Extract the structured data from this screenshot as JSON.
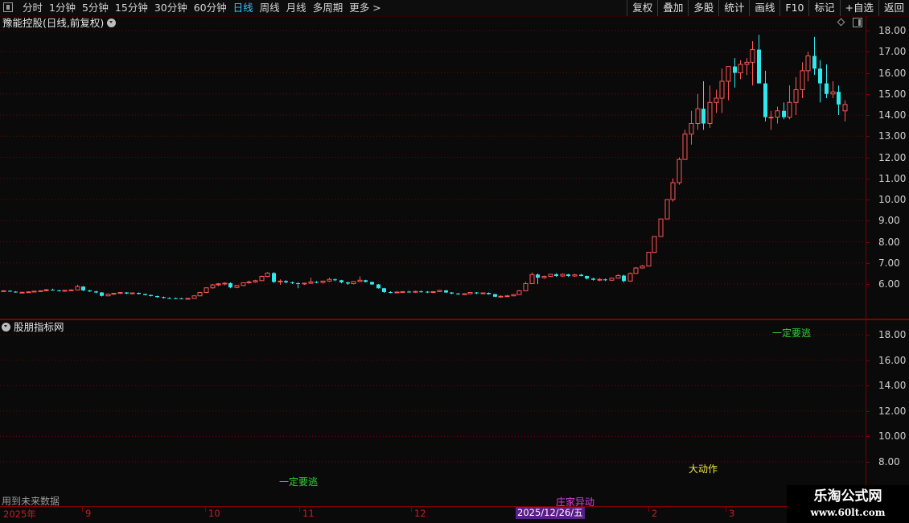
{
  "toolbar": {
    "periods": [
      "分时",
      "1分钟",
      "5分钟",
      "15分钟",
      "30分钟",
      "60分钟",
      "日线",
      "周线",
      "月线",
      "多周期",
      "更多 >"
    ],
    "active_period": "日线",
    "right_buttons": [
      "复权",
      "叠加",
      "多股",
      "统计",
      "画线",
      "F10",
      "标记",
      "+自选",
      "返回"
    ]
  },
  "main_panel": {
    "title": "豫能控股(日线,前复权)",
    "y_ticks": [
      "18.00",
      "17.00",
      "16.00",
      "15.00",
      "14.00",
      "13.00",
      "12.00",
      "11.00",
      "10.00",
      "9.00",
      "8.00",
      "7.00",
      "6.00"
    ]
  },
  "sub_panel": {
    "title": "股朋指标网",
    "y_ticks": [
      "18.00",
      "16.00",
      "14.00",
      "12.00",
      "10.00",
      "8.00"
    ],
    "signals": {
      "yiding_yaotao_1": "一定要逃",
      "yiding_yaotao_2": "一定要逃",
      "dadongzuo": "大动作",
      "zhuangjia_yidong": "庄家异动"
    },
    "future_data_note": "用到未来数据"
  },
  "x_axis": {
    "labels": [
      "2025年",
      "9",
      "10",
      "11",
      "12",
      "2",
      "3"
    ],
    "cursor_date": "2025/12/26/五"
  },
  "watermark": {
    "line1": "乐淘公式网",
    "line2": "www.60lt.com"
  },
  "colors": {
    "up": "#ff5555",
    "down": "#2ee8ee",
    "frame": "#800000",
    "active_tab": "#2ec7ff"
  },
  "chart_data": {
    "type": "candlestick",
    "title": "豫能控股(日线,前复权)",
    "ylim": [
      5.0,
      18.3
    ],
    "x_labels": [
      "2025年",
      "9",
      "10",
      "11",
      "12",
      "2025/12/26/五",
      "2",
      "3"
    ],
    "candles": [
      [
        5.66,
        5.7,
        5.64,
        5.68
      ],
      [
        5.68,
        5.7,
        5.63,
        5.64
      ],
      [
        5.64,
        5.66,
        5.59,
        5.6
      ],
      [
        5.6,
        5.63,
        5.56,
        5.61
      ],
      [
        5.61,
        5.65,
        5.58,
        5.63
      ],
      [
        5.63,
        5.68,
        5.61,
        5.66
      ],
      [
        5.66,
        5.7,
        5.63,
        5.68
      ],
      [
        5.68,
        5.76,
        5.66,
        5.73
      ],
      [
        5.73,
        5.78,
        5.69,
        5.7
      ],
      [
        5.7,
        5.73,
        5.65,
        5.67
      ],
      [
        5.67,
        5.72,
        5.64,
        5.7
      ],
      [
        5.7,
        5.75,
        5.67,
        5.72
      ],
      [
        5.72,
        5.96,
        5.7,
        5.88
      ],
      [
        5.88,
        5.9,
        5.66,
        5.7
      ],
      [
        5.7,
        5.72,
        5.63,
        5.65
      ],
      [
        5.65,
        5.68,
        5.56,
        5.6
      ],
      [
        5.6,
        5.62,
        5.41,
        5.44
      ],
      [
        5.44,
        5.55,
        5.42,
        5.52
      ],
      [
        5.52,
        5.58,
        5.49,
        5.56
      ],
      [
        5.56,
        5.62,
        5.53,
        5.6
      ],
      [
        5.6,
        5.62,
        5.52,
        5.55
      ],
      [
        5.55,
        5.6,
        5.52,
        5.58
      ],
      [
        5.58,
        5.6,
        5.51,
        5.53
      ],
      [
        5.53,
        5.55,
        5.46,
        5.48
      ],
      [
        5.48,
        5.5,
        5.41,
        5.43
      ],
      [
        5.43,
        5.45,
        5.35,
        5.38
      ],
      [
        5.38,
        5.41,
        5.31,
        5.34
      ],
      [
        5.34,
        5.37,
        5.3,
        5.33
      ],
      [
        5.33,
        5.36,
        5.29,
        5.32
      ],
      [
        5.32,
        5.35,
        5.29,
        5.31
      ],
      [
        5.31,
        5.34,
        5.29,
        5.32
      ],
      [
        5.32,
        5.47,
        5.3,
        5.44
      ],
      [
        5.44,
        5.63,
        5.42,
        5.6
      ],
      [
        5.6,
        5.85,
        5.58,
        5.82
      ],
      [
        5.82,
        6.0,
        5.78,
        5.96
      ],
      [
        5.96,
        6.05,
        5.9,
        6.01
      ],
      [
        6.01,
        6.08,
        5.94,
        6.04
      ],
      [
        6.04,
        6.08,
        5.8,
        5.84
      ],
      [
        5.84,
        5.96,
        5.8,
        5.93
      ],
      [
        5.93,
        6.08,
        5.9,
        6.06
      ],
      [
        6.06,
        6.16,
        6.02,
        6.1
      ],
      [
        6.1,
        6.2,
        6.06,
        6.16
      ],
      [
        6.16,
        6.4,
        6.14,
        6.36
      ],
      [
        6.36,
        6.56,
        6.33,
        6.52
      ],
      [
        6.52,
        6.56,
        6.05,
        6.1
      ],
      [
        6.1,
        6.22,
        5.96,
        6.14
      ],
      [
        6.14,
        6.18,
        6.04,
        6.08
      ],
      [
        6.08,
        6.12,
        6.0,
        6.04
      ],
      [
        6.04,
        6.08,
        5.8,
        6.02
      ],
      [
        6.02,
        6.06,
        5.96,
        6.04
      ],
      [
        6.04,
        6.3,
        6.0,
        6.1
      ],
      [
        6.1,
        6.14,
        6.04,
        6.08
      ],
      [
        6.08,
        6.14,
        6.02,
        6.14
      ],
      [
        6.14,
        6.3,
        6.1,
        6.22
      ],
      [
        6.22,
        6.26,
        6.14,
        6.18
      ],
      [
        6.18,
        6.2,
        6.04,
        6.08
      ],
      [
        6.08,
        6.1,
        5.96,
        6.02
      ],
      [
        6.02,
        6.14,
        5.98,
        6.12
      ],
      [
        6.12,
        6.36,
        6.1,
        6.18
      ],
      [
        6.18,
        6.2,
        6.08,
        6.1
      ],
      [
        6.1,
        6.12,
        5.96,
        5.98
      ],
      [
        5.98,
        6.0,
        5.78,
        5.8
      ],
      [
        5.8,
        5.82,
        5.58,
        5.62
      ],
      [
        5.62,
        5.66,
        5.56,
        5.6
      ],
      [
        5.6,
        5.66,
        5.56,
        5.62
      ],
      [
        5.62,
        5.66,
        5.59,
        5.64
      ],
      [
        5.64,
        5.68,
        5.59,
        5.62
      ],
      [
        5.62,
        5.68,
        5.58,
        5.65
      ],
      [
        5.65,
        5.7,
        5.6,
        5.64
      ],
      [
        5.64,
        5.66,
        5.57,
        5.6
      ],
      [
        5.6,
        5.66,
        5.58,
        5.64
      ],
      [
        5.64,
        5.72,
        5.62,
        5.7
      ],
      [
        5.7,
        5.72,
        5.58,
        5.6
      ],
      [
        5.6,
        5.62,
        5.52,
        5.55
      ],
      [
        5.55,
        5.58,
        5.5,
        5.52
      ],
      [
        5.52,
        5.56,
        5.48,
        5.54
      ],
      [
        5.54,
        5.62,
        5.52,
        5.6
      ],
      [
        5.6,
        5.62,
        5.52,
        5.56
      ],
      [
        5.56,
        5.6,
        5.52,
        5.58
      ],
      [
        5.58,
        5.6,
        5.5,
        5.52
      ],
      [
        5.52,
        5.54,
        5.38,
        5.4
      ],
      [
        5.4,
        5.46,
        5.36,
        5.42
      ],
      [
        5.42,
        5.48,
        5.4,
        5.44
      ],
      [
        5.44,
        5.52,
        5.42,
        5.5
      ],
      [
        5.5,
        5.72,
        5.48,
        5.68
      ],
      [
        5.68,
        6.1,
        5.66,
        6.02
      ],
      [
        6.02,
        6.55,
        6.0,
        6.45
      ],
      [
        6.45,
        6.5,
        6.0,
        6.3
      ],
      [
        6.3,
        6.4,
        6.25,
        6.36
      ],
      [
        6.36,
        6.48,
        6.34,
        6.46
      ],
      [
        6.46,
        6.52,
        6.34,
        6.38
      ],
      [
        6.38,
        6.5,
        6.34,
        6.46
      ],
      [
        6.46,
        6.48,
        6.34,
        6.38
      ],
      [
        6.38,
        6.48,
        6.34,
        6.44
      ],
      [
        6.44,
        6.48,
        6.36,
        6.38
      ],
      [
        6.38,
        6.4,
        6.22,
        6.26
      ],
      [
        6.26,
        6.3,
        6.16,
        6.2
      ],
      [
        6.2,
        6.28,
        6.14,
        6.22
      ],
      [
        6.22,
        6.26,
        6.14,
        6.18
      ],
      [
        6.18,
        6.3,
        6.16,
        6.28
      ],
      [
        6.28,
        6.46,
        6.26,
        6.4
      ],
      [
        6.4,
        6.44,
        6.08,
        6.14
      ],
      [
        6.14,
        6.55,
        6.12,
        6.5
      ],
      [
        6.5,
        6.8,
        6.48,
        6.76
      ],
      [
        6.76,
        6.9,
        6.74,
        6.85
      ],
      [
        6.85,
        7.5,
        6.85,
        7.5
      ],
      [
        7.5,
        8.25,
        7.5,
        8.25
      ],
      [
        8.25,
        9.08,
        8.25,
        9.08
      ],
      [
        9.08,
        10.0,
        9.08,
        10.0
      ],
      [
        10.0,
        11.0,
        9.9,
        10.8
      ],
      [
        10.8,
        12.0,
        10.7,
        11.9
      ],
      [
        11.9,
        13.3,
        12.6,
        13.1
      ],
      [
        13.1,
        14.2,
        12.6,
        13.6
      ],
      [
        13.6,
        15.0,
        13.3,
        14.3
      ],
      [
        14.3,
        15.6,
        13.3,
        13.6
      ],
      [
        13.6,
        15.4,
        13.4,
        14.6
      ],
      [
        14.6,
        15.2,
        14.1,
        14.8
      ],
      [
        14.8,
        16.2,
        14.1,
        15.6
      ],
      [
        15.6,
        16.3,
        14.7,
        16.3
      ],
      [
        16.3,
        16.7,
        15.3,
        16.0
      ],
      [
        16.0,
        16.6,
        15.7,
        16.4
      ],
      [
        16.4,
        16.7,
        15.9,
        16.5
      ],
      [
        16.5,
        17.5,
        15.4,
        17.1
      ],
      [
        17.1,
        17.8,
        15.5,
        15.5
      ],
      [
        15.5,
        16.1,
        13.7,
        13.9
      ],
      [
        13.9,
        14.2,
        13.3,
        13.9
      ],
      [
        13.9,
        14.4,
        13.6,
        14.2
      ],
      [
        14.2,
        14.6,
        13.8,
        13.9
      ],
      [
        13.9,
        15.4,
        13.8,
        14.6
      ],
      [
        14.6,
        15.8,
        14.0,
        15.2
      ],
      [
        15.2,
        16.5,
        14.8,
        16.1
      ],
      [
        16.1,
        17.0,
        15.6,
        16.8
      ],
      [
        16.8,
        17.7,
        15.9,
        16.2
      ],
      [
        16.2,
        16.6,
        14.6,
        15.5
      ],
      [
        15.5,
        16.4,
        14.8,
        15.0
      ],
      [
        15.0,
        15.6,
        14.8,
        15.1
      ],
      [
        15.1,
        15.4,
        14.0,
        14.5
      ],
      [
        14.2,
        14.7,
        13.7,
        14.5
      ]
    ]
  }
}
